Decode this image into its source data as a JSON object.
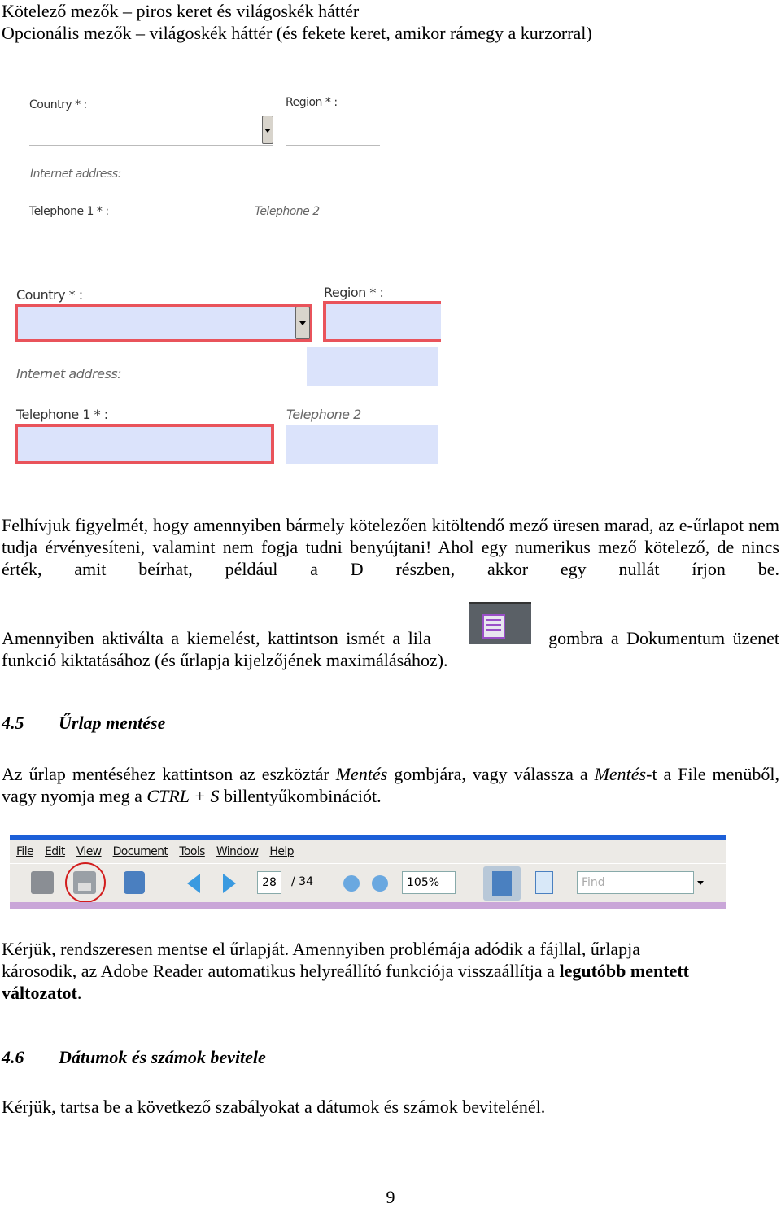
{
  "intro": {
    "line1": "Kötelező mezők – piros keret és világoskék háttér",
    "line2": "Opcionális mezők – világoskék háttér (és fekete keret, amikor rámegy a kurzorral)"
  },
  "form_plain": {
    "country": "Country * :",
    "region": "Region * :",
    "internet": "Internet address:",
    "tel1": "Telephone 1 * :",
    "tel2": "Telephone 2"
  },
  "form_highlighted": {
    "country": "Country * :",
    "region": "Region * :",
    "internet": "Internet address:",
    "tel1": "Telephone 1 * :",
    "tel2": "Telephone 2"
  },
  "colors": {
    "required_border": "#e9535b",
    "field_bg": "#dbe3fb"
  },
  "para1": "Felhívjuk figyelmét, hogy amennyiben bármely kötelezően kitöltendő mező üresen marad, az e-űrlapot nem tudja érvényesíteni, valamint nem fogja tudni benyújtani! Ahol egy numerikus mező kötelező, de nincs érték, amit beírhat, például a D részben, akkor egy nullát írjon be.",
  "para2": {
    "before": "Amennyiben aktiválta a kiemelést, kattintson ismét a lila",
    "after": "gombra a Dokumentum üzenet",
    "line2": "funkció kiktatásához (és űrlapja kijelzőjének maximálásához)."
  },
  "section45": {
    "number": "4.5",
    "title": "Űrlap mentése"
  },
  "para3": {
    "a": "Az űrlap mentéséhez kattintson az eszköztár ",
    "b": "Mentés",
    "c": " gombjára, vagy válassza a ",
    "d": "Mentés",
    "e": "-t a File menüből, vagy nyomja meg a ",
    "f": "CTRL + S",
    "g": " billentyűkombinációt."
  },
  "toolbar": {
    "menu": [
      "File",
      "Edit",
      "View",
      "Document",
      "Tools",
      "Window",
      "Help"
    ],
    "page": "28",
    "total": "/ 34",
    "zoom": "105%",
    "find_placeholder": "Find"
  },
  "para4": {
    "line1": "Kérjük, rendszeresen mentse el űrlapját. Amennyiben problémája adódik a fájllal, űrlapja",
    "line2a": "károsodik, az Adobe Reader automatikus helyreállító funkciója visszaállítja a ",
    "line2b": "legutóbb mentett",
    "line3a": "változatot",
    "line3b": "."
  },
  "section46": {
    "number": "4.6",
    "title": "Dátumok és számok bevitele"
  },
  "para5": "Kérjük, tartsa be a következő szabályokat a dátumok és számok bevitelénél.",
  "page_number": "9"
}
